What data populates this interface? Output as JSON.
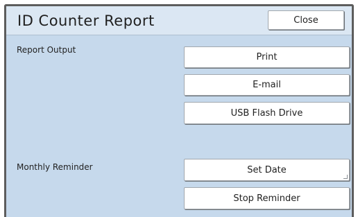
{
  "dialog": {
    "title": "ID Counter Report",
    "close_label": "Close"
  },
  "report_output": {
    "label": "Report Output",
    "buttons": [
      "Print",
      "E-mail",
      "USB Flash Drive"
    ]
  },
  "monthly_reminder": {
    "label": "Monthly Reminder",
    "buttons": [
      "Set Date",
      "Stop Reminder"
    ]
  },
  "colors": {
    "panel_background": "#c6d9ec",
    "header_background": "#dbe7f3",
    "button_background": "#ffffff",
    "border": "#5d5d5d"
  }
}
